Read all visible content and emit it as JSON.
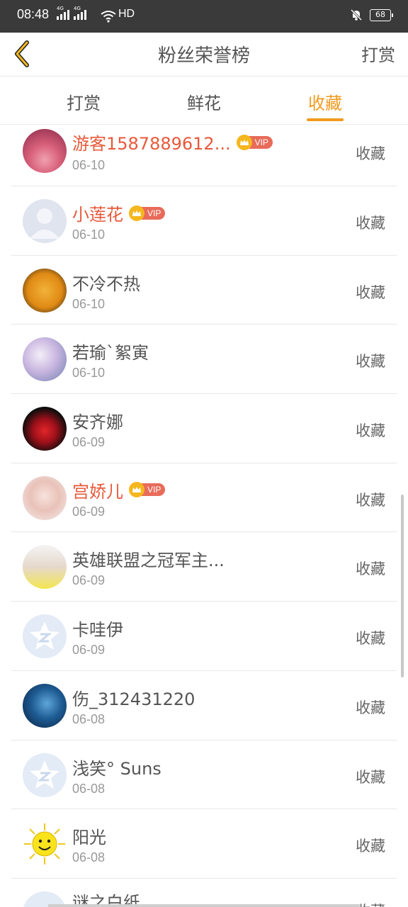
{
  "status": {
    "time": "08:48",
    "network_tag_1": "4G",
    "network_tag_2": "4G",
    "hd_label": "HD",
    "battery": "68"
  },
  "header": {
    "back_icon": "chevron-left-icon",
    "title": "粉丝荣誉榜",
    "reward_label": "打赏"
  },
  "tabs": [
    {
      "label": "打赏",
      "active": false
    },
    {
      "label": "鲜花",
      "active": false
    },
    {
      "label": "收藏",
      "active": true
    }
  ],
  "vip_label": "VIP",
  "colors": {
    "accent": "#f29a1f",
    "vip_name": "#e8593a",
    "vip_badge": "#e86b5a",
    "crown": "#f5b71e"
  },
  "rows": [
    {
      "name": "游客1587889612...",
      "date": "06-10",
      "action": "收藏",
      "vip": true
    },
    {
      "name": "小莲花",
      "date": "06-10",
      "action": "收藏",
      "vip": true
    },
    {
      "name": "不冷不热",
      "date": "06-10",
      "action": "收藏",
      "vip": false
    },
    {
      "name": "若瑜`絮寅",
      "date": "06-10",
      "action": "收藏",
      "vip": false
    },
    {
      "name": "安齐娜",
      "date": "06-09",
      "action": "收藏",
      "vip": false
    },
    {
      "name": "宫娇儿",
      "date": "06-09",
      "action": "收藏",
      "vip": true
    },
    {
      "name": "英雄联盟之冠军主...",
      "date": "06-09",
      "action": "收藏",
      "vip": false
    },
    {
      "name": "卡哇伊",
      "date": "06-09",
      "action": "收藏",
      "vip": false
    },
    {
      "name": "伤_312431220",
      "date": "06-08",
      "action": "收藏",
      "vip": false
    },
    {
      "name": "浅笑° Suns",
      "date": "06-08",
      "action": "收藏",
      "vip": false
    },
    {
      "name": "阳光",
      "date": "06-08",
      "action": "收藏",
      "vip": false
    },
    {
      "name": "谜之白纸",
      "date": "",
      "action": "收藏",
      "vip": false
    }
  ]
}
